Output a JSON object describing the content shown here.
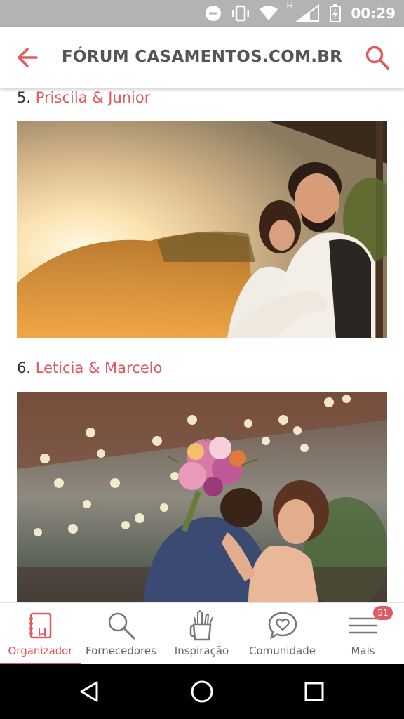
{
  "status_bar": {
    "time": "00:29",
    "network_label": "H",
    "icons": [
      "minus-circle-icon",
      "vibrate-icon",
      "wifi-icon",
      "signal-icon",
      "battery-charging-icon"
    ]
  },
  "app_bar": {
    "title": "FÓRUM CASAMENTOS.COM.BR",
    "accent_color": "#e05a5f"
  },
  "posts": [
    {
      "number": "5.",
      "couple": "Priscila & Junior"
    },
    {
      "number": "6.",
      "couple": "Leticia & Marcelo"
    }
  ],
  "bottom_nav": {
    "items": [
      {
        "label": "Organizador",
        "icon": "notebook-icon",
        "active": true
      },
      {
        "label": "Fornecedores",
        "icon": "search-icon"
      },
      {
        "label": "Inspiração",
        "icon": "pencil-cup-icon"
      },
      {
        "label": "Comunidade",
        "icon": "heart-chat-icon"
      },
      {
        "label": "Mais",
        "icon": "menu-icon",
        "badge": "51"
      }
    ]
  },
  "system_nav": {
    "icons": [
      "back-triangle-icon",
      "home-circle-icon",
      "recents-square-icon"
    ]
  }
}
